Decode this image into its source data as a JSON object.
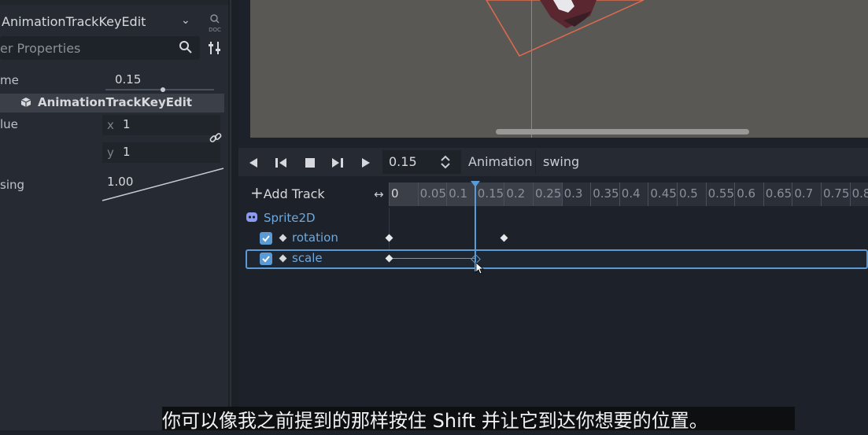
{
  "inspector": {
    "object_title": "AnimationTrackKeyEdit",
    "doc_label": "DOC",
    "filter_placeholder": "er Properties",
    "properties": {
      "time_label": "me",
      "time_value": "0.15",
      "section_title": "AnimationTrackKeyEdit",
      "value_label": "lue",
      "value_x_axis": "x",
      "value_x": "1",
      "value_y_axis": "y",
      "value_y": "1",
      "easing_label": "sing",
      "easing_value": "1.00"
    }
  },
  "animation_panel": {
    "time_value": "0.15",
    "animation_label": "Animation",
    "animation_name": "swing",
    "add_track_label": "Add Track",
    "zoom_arrows": "↔",
    "ruler_ticks": [
      "0",
      "0.05",
      "0.1",
      "0.15",
      "0.2",
      "0.25",
      "0.3",
      "0.35",
      "0.4",
      "0.45",
      "0.5",
      "0.55",
      "0.6",
      "0.65",
      "0.7",
      "0.75",
      "0.8"
    ],
    "node_name": "Sprite2D",
    "tracks": [
      {
        "name": "rotation",
        "enabled": true,
        "keyframes": [
          0,
          0.2
        ]
      },
      {
        "name": "scale",
        "enabled": true,
        "selected": true,
        "keyframes": [
          0,
          0.15
        ]
      }
    ],
    "playhead_time": 0.15
  },
  "subtitle": "你可以像我之前提到的那样按住 Shift 并让它到达你想要的位置。",
  "colors": {
    "accent": "#5b9bd5",
    "panel_bg": "#262b33",
    "editor_bg": "#1d2129",
    "viewport_bg": "#5a5855"
  }
}
